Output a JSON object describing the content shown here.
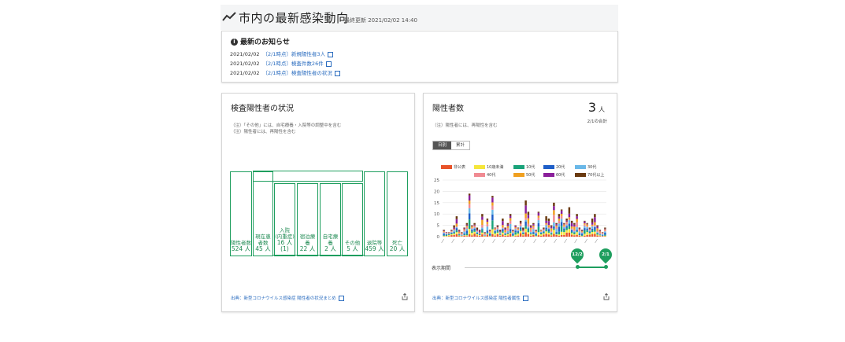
{
  "header": {
    "title": "市内の最新感染動向",
    "last_updated": "最終更新 2021/02/02 14:40"
  },
  "news": {
    "heading": "最新のお知らせ",
    "items": [
      {
        "date": "2021/02/02",
        "text": "〔2/1時点〕新規陽性者3人"
      },
      {
        "date": "2021/02/02",
        "text": "〔2/1時点〕検査件数26件"
      },
      {
        "date": "2021/02/02",
        "text": "〔2/1時点〕検査陽性者の状況"
      }
    ]
  },
  "status": {
    "title": "検査陽性者の状況",
    "notes": [
      "（注）「その他」には、自宅療養・入院等の調整中を含む",
      "（注）陽性者には、再陽性を含む"
    ],
    "boxes": {
      "positive": {
        "label": "陽性者数",
        "value": "524 人"
      },
      "current": {
        "label": "現在患者数",
        "value": "45 人"
      },
      "hospital": {
        "label": "入院\n(内重症)",
        "value": "16 人",
        "sub": "(1)"
      },
      "hotel": {
        "label": "宿泊療養",
        "value": "22 人"
      },
      "home": {
        "label": "自宅療養",
        "value": "2 人"
      },
      "other": {
        "label": "その他",
        "value": "5 人"
      },
      "recovered": {
        "label": "退院等",
        "value": "459 人"
      },
      "deaths": {
        "label": "死亡",
        "value": "20 人"
      }
    },
    "source": "出典：新型コロナウイルス感染症 陽性者の状況まとめ"
  },
  "positives": {
    "title": "陽性者数",
    "value": "3",
    "unit": "人",
    "as_of": "2/1の合計",
    "note": "（注）陽性者には、再陽性を含む",
    "toggle": {
      "daily": "日別",
      "cumulative": "累計"
    },
    "period_label": "表示期間",
    "range_start": "12/2",
    "range_end": "2/1",
    "source": "出典：新型コロナウイルス感染症 陽性者属性"
  },
  "chart_data": {
    "type": "bar",
    "stacked": true,
    "ylim": [
      0,
      25
    ],
    "yticks": [
      0,
      5,
      10,
      15,
      20,
      25
    ],
    "series": [
      {
        "name": "非公表",
        "color": "#e8532a"
      },
      {
        "name": "10歳未満",
        "color": "#f5e63b"
      },
      {
        "name": "10代",
        "color": "#1aa37a"
      },
      {
        "name": "20代",
        "color": "#1f5fc8"
      },
      {
        "name": "30代",
        "color": "#6ab8e8"
      },
      {
        "name": "40代",
        "color": "#f08a92"
      },
      {
        "name": "50代",
        "color": "#f0a020"
      },
      {
        "name": "60代",
        "color": "#8a1f9a"
      },
      {
        "name": "70代以上",
        "color": "#6a3a10"
      }
    ],
    "totals": [
      3,
      2,
      2,
      3,
      5,
      9,
      3,
      2,
      4,
      6,
      19,
      5,
      6,
      4,
      3,
      10,
      2,
      8,
      3,
      18,
      4,
      5,
      3,
      8,
      4,
      6,
      10,
      3,
      5,
      4,
      7,
      4,
      16,
      11,
      5,
      6,
      3,
      11,
      3,
      4,
      9,
      8,
      5,
      15,
      6,
      10,
      12,
      6,
      8,
      13,
      7,
      6,
      10,
      4,
      3,
      7,
      6,
      4,
      8,
      10,
      5,
      3,
      2,
      4
    ],
    "grid": true
  }
}
